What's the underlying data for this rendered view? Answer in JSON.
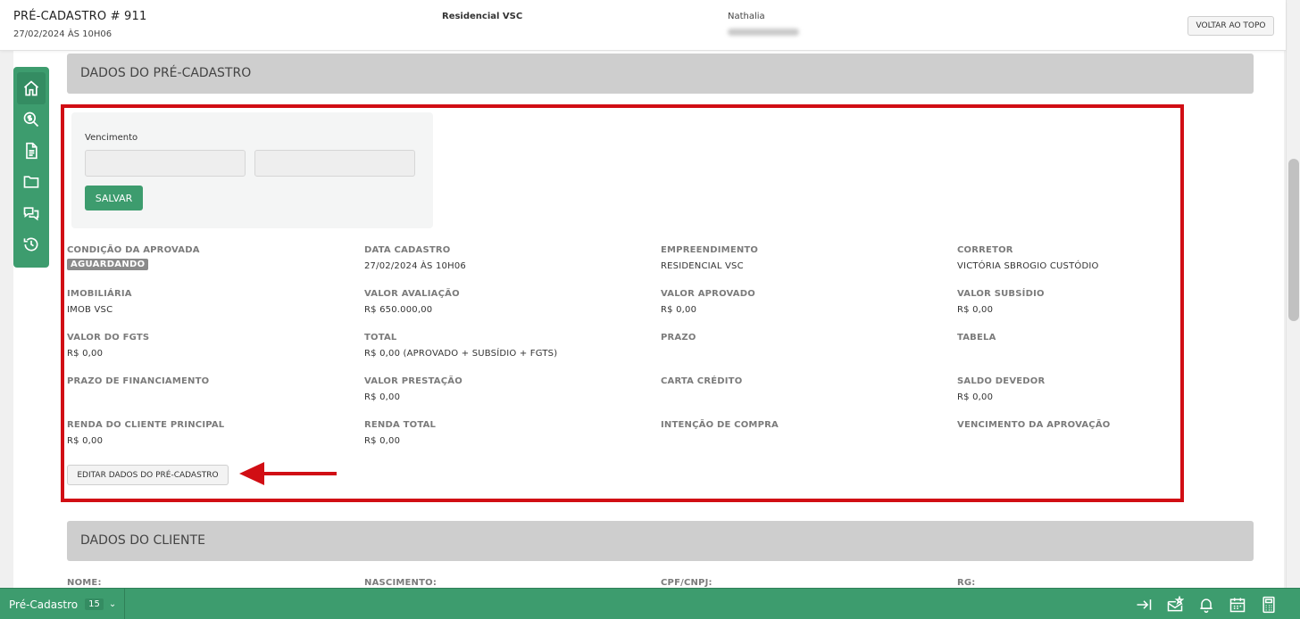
{
  "header": {
    "title": "PRÉ-CADASTRO # 911",
    "date": "27/02/2024 ÀS 10H06",
    "empreendimento": "Residencial VSC",
    "user": "Nathalia",
    "back_to_top": "VOLTAR AO TOPO"
  },
  "sidebar": {
    "icons": [
      "home-icon",
      "search-money-icon",
      "document-icon",
      "folder-icon",
      "chat-icon",
      "history-icon"
    ]
  },
  "section1": {
    "title": "DADOS DO PRÉ-CADASTRO",
    "vencimento_label": "Vencimento",
    "vencimento_value1": "",
    "vencimento_value2": "",
    "save_label": "SALVAR",
    "fields": [
      {
        "label": "CONDIÇÃO DA APROVADA",
        "value": "AGUARDANDO"
      },
      {
        "label": "DATA CADASTRO",
        "value": "27/02/2024 ÀS 10H06"
      },
      {
        "label": "EMPREENDIMENTO",
        "value": "RESIDENCIAL VSC"
      },
      {
        "label": "CORRETOR",
        "value": "VICTÓRIA SBROGIO CUSTÓDIO"
      },
      {
        "label": "IMOBILIÁRIA",
        "value": "IMOB VSC"
      },
      {
        "label": "VALOR AVALIAÇÃO",
        "value": "R$ 650.000,00"
      },
      {
        "label": "VALOR APROVADO",
        "value": "R$ 0,00"
      },
      {
        "label": "VALOR SUBSÍDIO",
        "value": "R$ 0,00"
      },
      {
        "label": "VALOR DO FGTS",
        "value": "R$ 0,00"
      },
      {
        "label": "TOTAL",
        "value": "R$ 0,00 (APROVADO + SUBSÍDIO + FGTS)"
      },
      {
        "label": "PRAZO",
        "value": ""
      },
      {
        "label": "TABELA",
        "value": ""
      },
      {
        "label": "PRAZO DE FINANCIAMENTO",
        "value": ""
      },
      {
        "label": "VALOR PRESTAÇÃO",
        "value": "R$ 0,00"
      },
      {
        "label": "CARTA CRÉDITO",
        "value": ""
      },
      {
        "label": "SALDO DEVEDOR",
        "value": "R$ 0,00"
      },
      {
        "label": "RENDA DO CLIENTE PRINCIPAL",
        "value": "R$ 0,00"
      },
      {
        "label": "RENDA TOTAL",
        "value": "R$ 0,00"
      },
      {
        "label": "INTENÇÃO DE COMPRA",
        "value": ""
      },
      {
        "label": "VENCIMENTO DA APROVAÇÃO",
        "value": ""
      }
    ],
    "edit_label": "EDITAR DADOS DO PRÉ-CADASTRO"
  },
  "section2": {
    "title": "DADOS DO CLIENTE",
    "fields": [
      {
        "label": "NOME:"
      },
      {
        "label": "NASCIMENTO:"
      },
      {
        "label": "CPF/CNPJ:"
      },
      {
        "label": "RG:"
      }
    ]
  },
  "footer": {
    "tab_label": "Pré-Cadastro",
    "tab_count": "15",
    "icons": [
      "collapse-right-icon",
      "mail-star-icon",
      "bell-icon",
      "calendar-icon",
      "calculator-icon"
    ]
  },
  "colors": {
    "brand_green": "#3d9c6e",
    "highlight_red": "#d10e14",
    "section_gray": "#cecece"
  }
}
